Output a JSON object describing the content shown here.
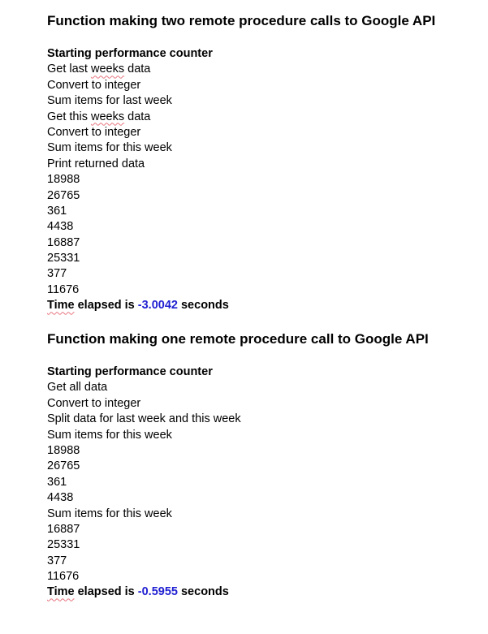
{
  "colors": {
    "text": "#000000",
    "elapsed_value": "#1f1fd2",
    "spellcheck_underline": "#e8757f"
  },
  "section1": {
    "heading": "Function making two remote procedure calls to Google API",
    "lines": [
      "Starting performance counter",
      "Get last ",
      "weeks",
      " data",
      "Convert to integer",
      "Sum items for last week",
      "Get this ",
      "weeks",
      " data",
      "Convert to integer",
      "Sum items for this week",
      "Print returned data",
      "18988",
      "26765",
      "361",
      "4438",
      "16887",
      "25331",
      "377",
      "11676"
    ],
    "elapsed": {
      "word": "Time",
      "prefix": " elapsed is ",
      "value": "-3.0042",
      "suffix": " seconds"
    }
  },
  "section2": {
    "heading": "Function making one remote procedure call to Google API",
    "lines": [
      "Starting performance counter",
      "Get all data",
      "Convert to integer",
      "Split data for last week and this week",
      "Sum items for this week",
      "18988",
      "26765",
      "361",
      "4438",
      "Sum items for this week",
      "16887",
      "25331",
      "377",
      "11676"
    ],
    "elapsed": {
      "word": "Time",
      "prefix": " elapsed is ",
      "value": "-0.5955",
      "suffix": " seconds"
    }
  }
}
